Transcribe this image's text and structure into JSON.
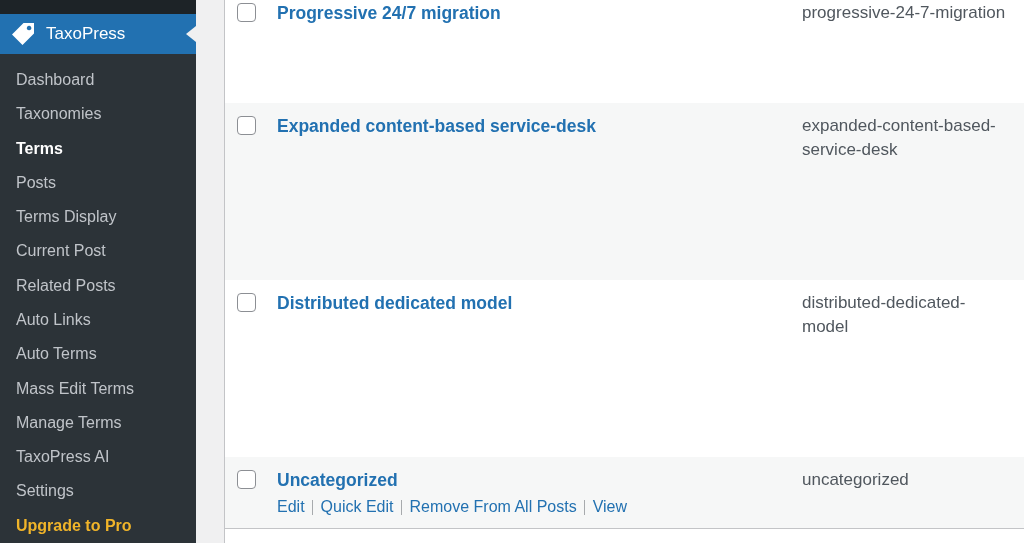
{
  "sidebar": {
    "menu": {
      "label": "TaxoPress",
      "current": true
    },
    "items": [
      {
        "label": "Dashboard",
        "kind": "link",
        "selected": false
      },
      {
        "label": "Taxonomies",
        "kind": "link",
        "selected": false
      },
      {
        "label": "Terms",
        "kind": "link",
        "selected": true
      },
      {
        "label": "Posts",
        "kind": "link",
        "selected": false
      },
      {
        "label": "Terms Display",
        "kind": "link",
        "selected": false
      },
      {
        "label": "Current Post",
        "kind": "link",
        "selected": false
      },
      {
        "label": "Related Posts",
        "kind": "link",
        "selected": false
      },
      {
        "label": "Auto Links",
        "kind": "link",
        "selected": false
      },
      {
        "label": "Auto Terms",
        "kind": "link",
        "selected": false
      },
      {
        "label": "Mass Edit Terms",
        "kind": "link",
        "selected": false
      },
      {
        "label": "Manage Terms",
        "kind": "link",
        "selected": false
      },
      {
        "label": "TaxoPress AI",
        "kind": "link",
        "selected": false
      },
      {
        "label": "Settings",
        "kind": "link",
        "selected": false
      },
      {
        "label": "Upgrade to Pro",
        "kind": "upgrade",
        "selected": false
      }
    ]
  },
  "table": {
    "rows": [
      {
        "name": "Progressive 24/7 migration",
        "slug": "progressive-24-7-migration",
        "checked": false
      },
      {
        "name": "Expanded content-based service-desk",
        "slug": "expanded-content-based-service-desk",
        "checked": false
      },
      {
        "name": "Distributed dedicated model",
        "slug": "distributed-dedicated-model",
        "checked": false
      },
      {
        "name": "Uncategorized",
        "slug": "uncategorized",
        "checked": false,
        "actions": [
          "Edit",
          "Quick Edit",
          "Remove From All Posts",
          "View"
        ]
      }
    ]
  }
}
